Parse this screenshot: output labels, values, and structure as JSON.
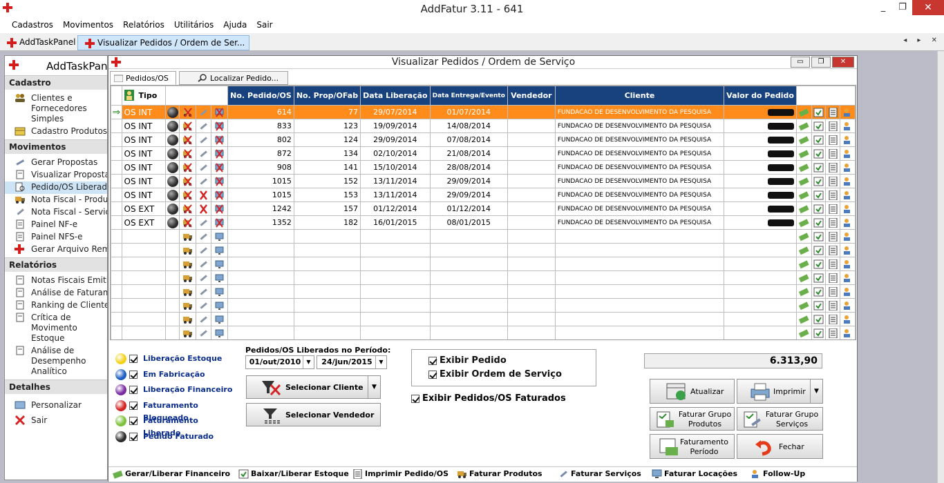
{
  "app": {
    "title": "AddFatur 3.11 - 641",
    "window_buttons": [
      "_",
      "❐",
      "✕"
    ]
  },
  "menu": [
    "Cadastros",
    "Movimentos",
    "Relatórios",
    "Utilitários",
    "Ajuda",
    "Sair"
  ],
  "mdi_tabs": [
    {
      "label": "AddTaskPanel"
    },
    {
      "label": "Visualizar Pedidos / Ordem de Ser..."
    }
  ],
  "tab_arrows": "◂ ▸ ✕",
  "sidebar": {
    "title": "AddTaskPanel",
    "sections": [
      {
        "title": "Cadastro",
        "items": [
          "Clientes e Fornecedores Simples",
          "Cadastro Produtos"
        ]
      },
      {
        "title": "Movimentos",
        "items": [
          "Gerar Propostas",
          "Visualizar Propostas",
          "Pedido/OS Liberados",
          "Nota Fiscal - Produtos",
          "Nota Fiscal - Serviços",
          "Painel NF-e",
          "Painel NFS-e",
          "Gerar Arquivo Remessa"
        ]
      },
      {
        "title": "Relatórios",
        "items": [
          "Notas Fiscais Emitidas",
          "Análise de Faturamento",
          "Ranking de Clientes",
          "Crítica de Movimento Estoque",
          "Análise de Desempenho Analítico"
        ]
      },
      {
        "title": "Detalhes",
        "items": [
          "Personalizar",
          "Sair"
        ]
      }
    ]
  },
  "window": {
    "title": "Visualizar Pedidos / Ordem de Serviço",
    "buttons": [
      "▭",
      "❐",
      "✕"
    ],
    "tabs": [
      {
        "label": "Pedidos/OS"
      },
      {
        "label": "Localizar Pedido..."
      }
    ]
  },
  "grid": {
    "headers": {
      "tipo": "Tipo",
      "pedido": "No. Pedido/OS",
      "prop": "No. Prop/OFab",
      "data_lib": "Data Liberação",
      "data_ent": "Data Entrega/Evento",
      "vendedor": "Vendedor",
      "cliente": "Cliente",
      "valor": "Valor do Pedido"
    },
    "rows": [
      {
        "tipo": "OS INT",
        "pedido": "614",
        "prop": "77",
        "data_lib": "29/07/2014",
        "data_ent": "01/07/2014",
        "vendedor": "",
        "cliente": "FUNDACAO DE DESENVOLVIMENTO DA PESQUISA",
        "selected": true
      },
      {
        "tipo": "OS INT",
        "pedido": "833",
        "prop": "123",
        "data_lib": "19/09/2014",
        "data_ent": "14/08/2014",
        "vendedor": "",
        "cliente": "FUNDACAO DE DESENVOLVIMENTO DA PESQUISA"
      },
      {
        "tipo": "OS INT",
        "pedido": "802",
        "prop": "124",
        "data_lib": "29/09/2014",
        "data_ent": "07/08/2014",
        "vendedor": "",
        "cliente": "FUNDACAO DE DESENVOLVIMENTO DA PESQUISA"
      },
      {
        "tipo": "OS INT",
        "pedido": "872",
        "prop": "134",
        "data_lib": "02/10/2014",
        "data_ent": "21/08/2014",
        "vendedor": "",
        "cliente": "FUNDACAO DE DESENVOLVIMENTO DA PESQUISA"
      },
      {
        "tipo": "OS INT",
        "pedido": "908",
        "prop": "141",
        "data_lib": "15/10/2014",
        "data_ent": "28/08/2014",
        "vendedor": "",
        "cliente": "FUNDACAO DE DESENVOLVIMENTO DA PESQUISA"
      },
      {
        "tipo": "OS INT",
        "pedido": "1015",
        "prop": "152",
        "data_lib": "13/11/2014",
        "data_ent": "29/09/2014",
        "vendedor": "",
        "cliente": "FUNDACAO DE DESENVOLVIMENTO DA PESQUISA"
      },
      {
        "tipo": "OS INT",
        "pedido": "1015",
        "prop": "153",
        "data_lib": "13/11/2014",
        "data_ent": "29/09/2014",
        "vendedor": "",
        "cliente": "FUNDACAO DE DESENVOLVIMENTO DA PESQUISA"
      },
      {
        "tipo": "OS EXT",
        "pedido": "1242",
        "prop": "157",
        "data_lib": "01/12/2014",
        "data_ent": "01/12/2014",
        "vendedor": "",
        "cliente": "FUNDACAO DE DESENVOLVIMENTO DA PESQUISA"
      },
      {
        "tipo": "OS EXT",
        "pedido": "1352",
        "prop": "182",
        "data_lib": "16/01/2015",
        "data_ent": "08/01/2015",
        "vendedor": "",
        "cliente": "FUNDACAO DE DESENVOLVIMENTO DA PESQUISA"
      }
    ],
    "empty_rows": 8
  },
  "legend": [
    {
      "label": "Liberação Estoque",
      "color": "#f2d21a"
    },
    {
      "label": "Em Fabricação",
      "color": "#1c5fc4"
    },
    {
      "label": "Liberação Financeiro",
      "color": "#7a2aa0"
    },
    {
      "label": "Faturamento Bloqueado",
      "color": "#d42424"
    },
    {
      "label": "Faturamento Liberado",
      "color": "#7cc23a"
    },
    {
      "label": "Pedido Faturado",
      "color": "#2b2b2b"
    }
  ],
  "period": {
    "label": "Pedidos/OS Liberados no Período:",
    "from": "01/out/2010",
    "to": "24/jun/2015"
  },
  "buttons": {
    "selecionar_cliente": "Selecionar Cliente",
    "selecionar_vendedor": "Selecionar Vendedor",
    "atualizar": "Atualizar",
    "imprimir": "Imprimir",
    "faturar_produtos": "Faturar Grupo Produtos",
    "faturar_servicos": "Faturar Grupo Serviços",
    "faturamento_periodo": "Faturamento Período",
    "fechar": "Fechar"
  },
  "options": {
    "exibir_pedido": "Exibir Pedido",
    "exibir_os": "Exibir Ordem de Serviço",
    "exibir_faturados": "Exibir Pedidos/OS Faturados"
  },
  "total": "6.313,90",
  "footer": [
    "Gerar/Liberar Financeiro",
    "Baixar/Liberar Estoque",
    "Imprimir Pedido/OS",
    "Faturar Produtos",
    "Faturar Serviços",
    "Faturar Locações",
    "Follow-Up"
  ]
}
